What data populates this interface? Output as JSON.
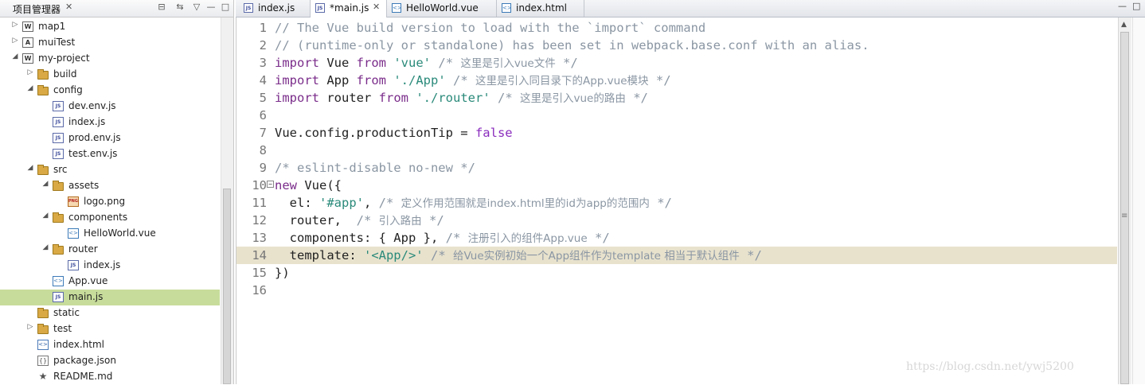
{
  "explorer": {
    "title": "项目管理器",
    "close": "✕",
    "toolbar": {
      "collapse": "⊟",
      "link": "⇆",
      "menu": "▽",
      "minimize": "—",
      "maximize": "□"
    },
    "tree": [
      {
        "label": "map1",
        "arrow": "▷",
        "icon": "project",
        "icon_text": "W"
      },
      {
        "label": "muiTest",
        "arrow": "▷",
        "icon": "project",
        "icon_text": "A"
      },
      {
        "label": "my-project",
        "arrow": "◢",
        "icon": "project",
        "icon_text": "W"
      },
      {
        "label": "build",
        "arrow": "▷",
        "icon": "folder"
      },
      {
        "label": "config",
        "arrow": "◢",
        "icon": "folder"
      },
      {
        "label": "dev.env.js",
        "arrow": "",
        "icon": "jsfile",
        "icon_text": "JS"
      },
      {
        "label": "index.js",
        "arrow": "",
        "icon": "jsfile",
        "icon_text": "JS"
      },
      {
        "label": "prod.env.js",
        "arrow": "",
        "icon": "jsfile",
        "icon_text": "JS"
      },
      {
        "label": "test.env.js",
        "arrow": "",
        "icon": "jsfile",
        "icon_text": "JS"
      },
      {
        "label": "src",
        "arrow": "◢",
        "icon": "folder"
      },
      {
        "label": "assets",
        "arrow": "◢",
        "icon": "folder"
      },
      {
        "label": "logo.png",
        "arrow": "",
        "icon": "png",
        "icon_text": "PNG"
      },
      {
        "label": "components",
        "arrow": "◢",
        "icon": "folder"
      },
      {
        "label": "HelloWorld.vue",
        "arrow": "",
        "icon": "vuefile",
        "icon_text": "<>"
      },
      {
        "label": "router",
        "arrow": "◢",
        "icon": "folder"
      },
      {
        "label": "index.js",
        "arrow": "",
        "icon": "jsfile",
        "icon_text": "JS"
      },
      {
        "label": "App.vue",
        "arrow": "",
        "icon": "vuefile",
        "icon_text": "<>"
      },
      {
        "label": "main.js",
        "arrow": "",
        "icon": "jsfile",
        "icon_text": "JS",
        "selected": true
      },
      {
        "label": "static",
        "arrow": "",
        "icon": "folder"
      },
      {
        "label": "test",
        "arrow": "▷",
        "icon": "folder"
      },
      {
        "label": "index.html",
        "arrow": "",
        "icon": "html",
        "icon_text": "<>"
      },
      {
        "label": "package.json",
        "arrow": "",
        "icon": "json",
        "icon_text": "{}"
      },
      {
        "label": "README.md",
        "arrow": "",
        "icon": "star",
        "icon_text": "★"
      }
    ]
  },
  "editor": {
    "tabs": [
      {
        "label": "index.js",
        "icon_text": "JS",
        "active": false,
        "close": ""
      },
      {
        "label": "*main.js",
        "icon_text": "JS",
        "active": true,
        "close": "✕"
      },
      {
        "label": "HelloWorld.vue",
        "icon_text": "<>",
        "active": false,
        "close": ""
      },
      {
        "label": "index.html",
        "icon_text": "<>",
        "active": false,
        "close": ""
      }
    ],
    "window_controls": {
      "minimize": "—",
      "maximize": "□"
    },
    "current_line": 14,
    "fold_marker_line": 10,
    "lines": [
      [
        [
          "cm",
          "// The Vue build version to load with the `import` command"
        ]
      ],
      [
        [
          "cm",
          "// (runtime-only or standalone) has been set in webpack.base.conf with an alias."
        ]
      ],
      [
        [
          "kw",
          "import"
        ],
        [
          "pl",
          " Vue "
        ],
        [
          "kw",
          "from"
        ],
        [
          "pl",
          " "
        ],
        [
          "str",
          "'vue'"
        ],
        [
          "pl",
          " "
        ],
        [
          "cm",
          "/* "
        ],
        [
          "cmcn",
          "这里是引入vue文件"
        ],
        [
          "cm",
          " */"
        ]
      ],
      [
        [
          "kw",
          "import"
        ],
        [
          "pl",
          " App "
        ],
        [
          "kw",
          "from"
        ],
        [
          "pl",
          " "
        ],
        [
          "str",
          "'./App'"
        ],
        [
          "pl",
          " "
        ],
        [
          "cm",
          "/* "
        ],
        [
          "cmcn",
          "这里是引入同目录下的App.vue模块"
        ],
        [
          "cm",
          " */"
        ]
      ],
      [
        [
          "kw",
          "import"
        ],
        [
          "pl",
          " router "
        ],
        [
          "kw",
          "from"
        ],
        [
          "pl",
          " "
        ],
        [
          "str",
          "'./router'"
        ],
        [
          "pl",
          " "
        ],
        [
          "cm",
          "/* "
        ],
        [
          "cmcn",
          "这里是引入vue的路由"
        ],
        [
          "cm",
          " */"
        ]
      ],
      [],
      [
        [
          "pl",
          "Vue.config.productionTip = "
        ],
        [
          "bool",
          "false"
        ]
      ],
      [],
      [
        [
          "cm",
          "/* eslint-disable no-new */"
        ]
      ],
      [
        [
          "kw",
          "new"
        ],
        [
          "pl",
          " Vue({"
        ]
      ],
      [
        [
          "pl",
          "  el: "
        ],
        [
          "str",
          "'#app'"
        ],
        [
          "pl",
          ", "
        ],
        [
          "cm",
          "/* "
        ],
        [
          "cmcn",
          "定义作用范围就是index.html里的id为app的范围内"
        ],
        [
          "cm",
          " */"
        ]
      ],
      [
        [
          "pl",
          "  router,  "
        ],
        [
          "cm",
          "/* "
        ],
        [
          "cmcn",
          "引入路由"
        ],
        [
          "cm",
          " */"
        ]
      ],
      [
        [
          "pl",
          "  components: { App }, "
        ],
        [
          "cm",
          "/* "
        ],
        [
          "cmcn",
          "注册引入的组件App.vue"
        ],
        [
          "cm",
          " */"
        ]
      ],
      [
        [
          "pl",
          "  template: "
        ],
        [
          "str",
          "'<App/>'"
        ],
        [
          "pl",
          " "
        ],
        [
          "cm",
          "/* "
        ],
        [
          "cmcn",
          "给Vue实例初始一个App组件作为template 相当于默认组件"
        ],
        [
          "cm",
          " */"
        ]
      ],
      [
        [
          "pl",
          "})"
        ]
      ],
      []
    ]
  },
  "watermark": "https://blog.csdn.net/ywj5200"
}
